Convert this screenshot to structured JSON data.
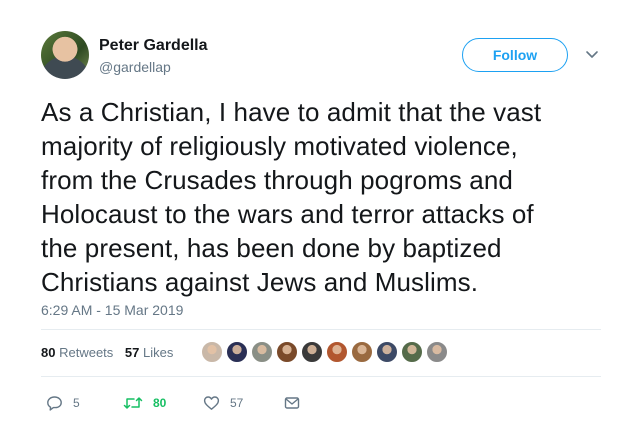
{
  "author": {
    "name": "Peter Gardella",
    "handle": "@gardellap"
  },
  "follow_label": "Follow",
  "tweet": {
    "lines": [
      "As a Christian, I have to admit that the vast",
      "majority of religiously motivated violence,",
      "from the Crusades through pogroms and",
      "Holocaust to the wars and terror attacks of",
      "the present, has been done by baptized",
      "Christians against Jews and Muslims."
    ],
    "timestamp": "6:29 AM - 15 Mar 2019"
  },
  "stats": {
    "retweets_count": "80",
    "retweets_label": "Retweets",
    "likes_count": "57",
    "likes_label": "Likes"
  },
  "likers": [
    {
      "color": "#c9b8a8"
    },
    {
      "color": "#2a2f55"
    },
    {
      "color": "#8a8f86"
    },
    {
      "color": "#7a4a2a"
    },
    {
      "color": "#3a3a3a"
    },
    {
      "color": "#b2572f"
    },
    {
      "color": "#9a6a40"
    },
    {
      "color": "#3d4a66"
    },
    {
      "color": "#556b4a"
    },
    {
      "color": "#8a8a8a"
    }
  ],
  "actions": {
    "reply_count": "5",
    "retweet_count": "80",
    "like_count": "57"
  },
  "colors": {
    "accent": "#1da1f2",
    "retweet_green": "#17bf63",
    "muted": "#657786"
  },
  "icons": {
    "reply": "reply-icon",
    "retweet": "retweet-icon",
    "like": "heart-icon",
    "dm": "envelope-icon",
    "caret": "chevron-down-icon"
  }
}
